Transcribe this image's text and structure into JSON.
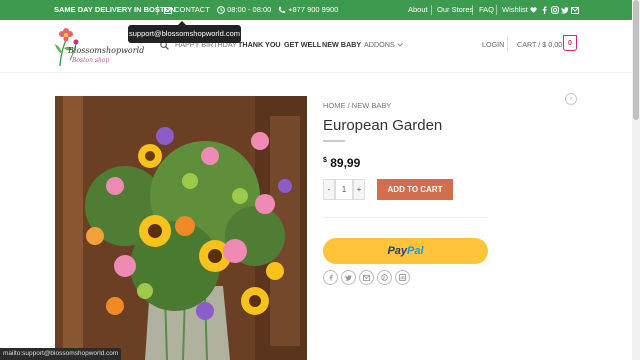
{
  "topbar": {
    "delivery": "SAME DAY DELIVERY IN BOSTON",
    "contact": "CONTACT",
    "hours": "08:00 - 08:00",
    "phone": "+877 900 9900",
    "about": "About",
    "stores": "Our Stores",
    "faq": "FAQ",
    "wishlist": "Wishlist"
  },
  "tooltip": "support@blossomshopworld.com",
  "logo": {
    "name": "Blossomshopworld",
    "city": "Boston shop"
  },
  "nav": {
    "birthday": "HAPPY BIRTHDAY",
    "thankyou": "THANK YOU",
    "getwell": "GET WELL",
    "newbaby": "NEW BABY",
    "addons": "ADDONS",
    "login": "LOGIN",
    "cart": "CART / $ 0,00",
    "cart_count": "0"
  },
  "breadcrumb": {
    "home": "HOME",
    "sep": "/",
    "category": "NEW BABY"
  },
  "product": {
    "title": "European Garden",
    "price_symbol": "$",
    "price": "89,99",
    "qty_minus": "-",
    "qty": "1",
    "qty_plus": "+",
    "add_to_cart": "ADD TO CART"
  },
  "paypal": {
    "part1": "Pay",
    "part2": "Pal"
  },
  "statusbar": "mailto:support@blossomshopworld.com",
  "colors": {
    "topbar": "#3d9b4f",
    "accent": "#d26e4b",
    "cart": "#d6267b",
    "paypal": "#ffc439"
  }
}
